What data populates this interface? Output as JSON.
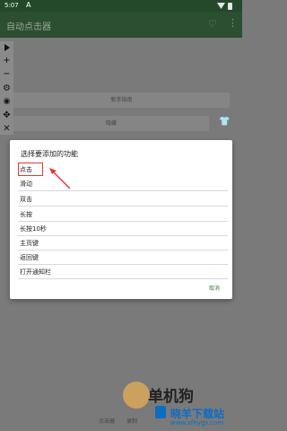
{
  "statusbar": {
    "time": "5:07",
    "notif_icon": "A"
  },
  "appbar": {
    "title": "自动点击器",
    "heart_icon": "heart-icon",
    "more_icon": "more-vert-icon"
  },
  "toolbar": {
    "tools": [
      {
        "icon": "play-icon"
      },
      {
        "icon": "plus-icon",
        "glyph": "+"
      },
      {
        "icon": "minus-icon",
        "glyph": "−"
      },
      {
        "icon": "gear-icon",
        "glyph": "⚙"
      },
      {
        "icon": "eye-off-icon",
        "glyph": "◉"
      },
      {
        "icon": "move-icon",
        "glyph": "✥"
      },
      {
        "icon": "close-icon",
        "glyph": "✕"
      }
    ]
  },
  "background": {
    "button1": "新手指南",
    "button2": "隐藏",
    "shirt_icon": "shirt-icon"
  },
  "dialog": {
    "title": "选择要添加的功能",
    "options": [
      "点击",
      "滑动",
      "双击",
      "长按",
      "长按10秒",
      "主页键",
      "返回键",
      "打开通知栏"
    ],
    "cancel": "取消"
  },
  "bottom": {
    "label1": "点击器",
    "label2": "录制"
  },
  "watermark": {
    "text1": "单机狗",
    "text2": "晓羊下载站",
    "text3": "www.xfhygs.com"
  },
  "colors": {
    "appbar": "#2c4e31",
    "accent": "#2e7d32",
    "highlight": "#e53935"
  }
}
